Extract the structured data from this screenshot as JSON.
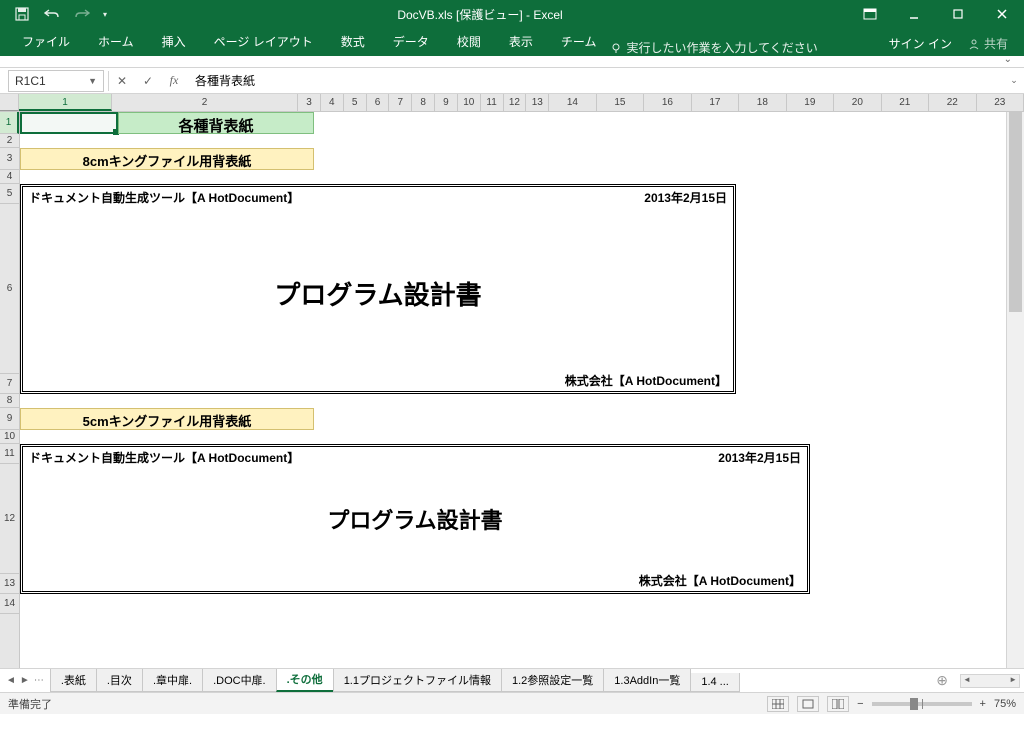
{
  "title": "DocVB.xls [保護ビュー] - Excel",
  "qat": {
    "save": "save",
    "undo": "undo",
    "redo": "redo"
  },
  "ribbon_tabs": [
    "ファイル",
    "ホーム",
    "挿入",
    "ページ レイアウト",
    "数式",
    "データ",
    "校閲",
    "表示",
    "チーム"
  ],
  "tellme": "実行したい作業を入力してください",
  "signin": "サイン イン",
  "share": "共有",
  "namebox": "R1C1",
  "formula": "各種背表紙",
  "col_labels": [
    "1",
    "2",
    "3",
    "4",
    "5",
    "6",
    "7",
    "8",
    "9",
    "10",
    "11",
    "12",
    "13",
    "14",
    "15",
    "16",
    "17",
    "18",
    "19",
    "20",
    "21",
    "22",
    "23"
  ],
  "row_labels": [
    "1",
    "2",
    "3",
    "4",
    "5",
    "6",
    "7",
    "8",
    "9",
    "10",
    "11",
    "12",
    "13",
    "14"
  ],
  "cells": {
    "title_block": "各種背表紙",
    "sub1": "8cmキングファイル用背表紙",
    "sub2": "5cmキングファイル用背表紙",
    "doc1": {
      "tool": "ドキュメント自動生成ツール【A HotDocument】",
      "date": "2013年2月15日",
      "title": "プログラム設計書",
      "company": "株式会社【A HotDocument】"
    },
    "doc2": {
      "tool": "ドキュメント自動生成ツール【A HotDocument】",
      "date": "2013年2月15日",
      "title": "プログラム設計書",
      "company": "株式会社【A HotDocument】"
    }
  },
  "sheet_tabs": [
    ".表紙",
    ".目次",
    ".章中扉.",
    ".DOC中扉.",
    ".その他",
    "1.1プロジェクトファイル情報",
    "1.2参照設定一覧",
    "1.3AddIn一覧",
    "1.4 ..."
  ],
  "active_sheet": 4,
  "status": "準備完了",
  "zoom": "75%"
}
